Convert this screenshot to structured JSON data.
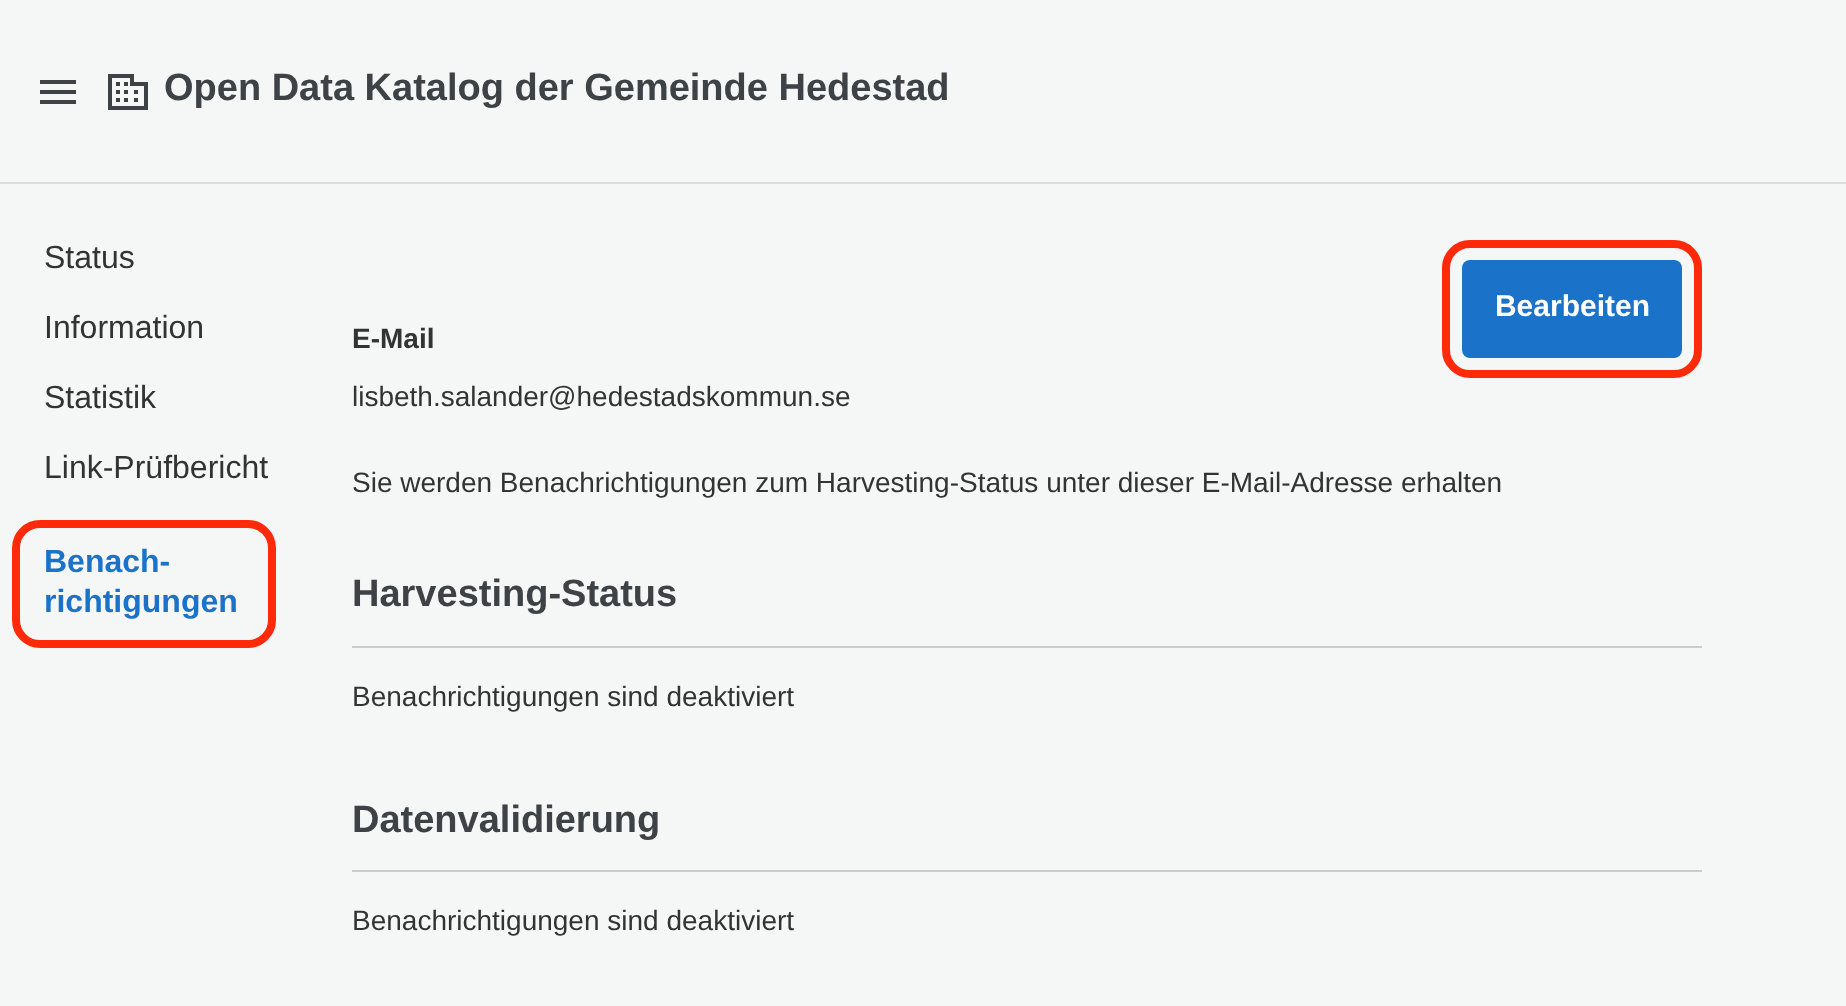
{
  "header": {
    "title": "Open Data Katalog der Gemeinde Hedestad"
  },
  "sidebar": {
    "items": [
      {
        "label": "Status",
        "selected": false,
        "highlighted": false
      },
      {
        "label": "Information",
        "selected": false,
        "highlighted": false
      },
      {
        "label": "Statistik",
        "selected": false,
        "highlighted": false
      },
      {
        "label": "Link-Prüfbericht",
        "selected": false,
        "highlighted": false
      },
      {
        "label": "Benach-richtigungen",
        "selected": true,
        "highlighted": true
      }
    ]
  },
  "edit_button": {
    "label": "Bearbeiten",
    "highlighted": true
  },
  "email": {
    "label": "E-Mail",
    "value": "lisbeth.salander@hedestadskommun.se",
    "note": "Sie werden Benachrichtigungen zum Harvesting-Status unter dieser E-Mail-Adresse erhalten"
  },
  "sections": [
    {
      "title": "Harvesting-Status",
      "text": "Benachrichtigungen sind deaktiviert"
    },
    {
      "title": "Datenvalidierung",
      "text": "Benachrichtigungen sind deaktiviert"
    }
  ]
}
